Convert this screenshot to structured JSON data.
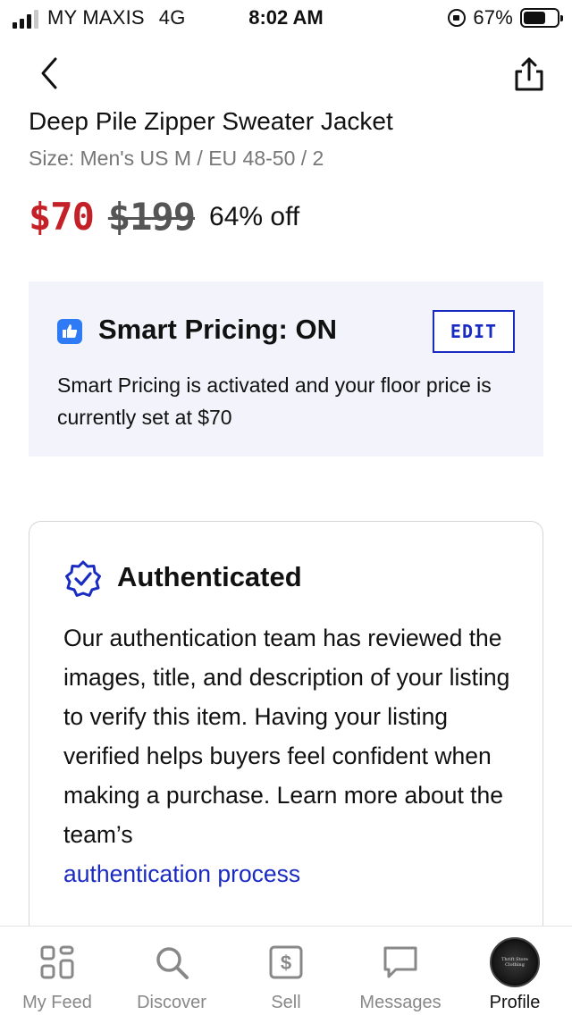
{
  "status_bar": {
    "carrier": "MY MAXIS",
    "network": "4G",
    "time": "8:02 AM",
    "battery": "67%",
    "battery_level": 0.67
  },
  "product": {
    "title": "Deep Pile Zipper Sweater Jacket",
    "size": "Size: Men's US M / EU 48-50 / 2",
    "price": "$70",
    "original_price": "$199",
    "discount": "64% off"
  },
  "smart_pricing": {
    "title": "Smart Pricing: ON",
    "edit_label": "EDIT",
    "description": "Smart Pricing is activated and your floor price is currently set at $70",
    "icon": "thumbs-up-icon"
  },
  "authenticated": {
    "title": "Authenticated",
    "description": "Our authentication team has reviewed the images, title, and description of your listing to verify this item. Having your listing verified helps buyers feel confident when making a purchase. Learn more about the team’s",
    "link_text": "authentication process",
    "icon": "verified-badge-icon"
  },
  "tab_bar": {
    "items": [
      {
        "label": "My Feed",
        "icon": "grid-icon"
      },
      {
        "label": "Discover",
        "icon": "search-icon"
      },
      {
        "label": "Sell",
        "icon": "dollar-icon"
      },
      {
        "label": "Messages",
        "icon": "chat-icon"
      },
      {
        "label": "Profile",
        "icon": "avatar"
      }
    ],
    "active_index": 4,
    "avatar_text": [
      "Thrift Store",
      "Clothing"
    ]
  },
  "colors": {
    "price_red": "#c42027",
    "accent_blue": "#1a2bc2",
    "smart_box_bg": "#f2f3fb",
    "thumbs_icon_blue": "#2f7bf5"
  }
}
